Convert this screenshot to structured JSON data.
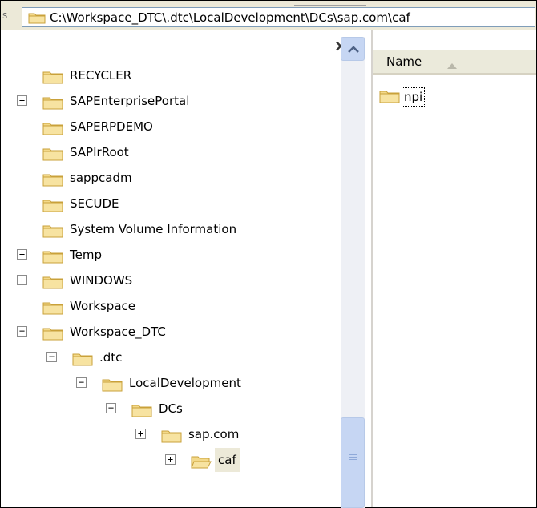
{
  "address": {
    "path": "C:\\Workspace_DTC\\.dtc\\LocalDevelopment\\DCs\\sap.com\\caf"
  },
  "tree": {
    "close_glyph": "×",
    "items": [
      {
        "label": "RECYCLER",
        "expander": "",
        "indent": 0,
        "icon": "folder-icon"
      },
      {
        "label": "SAPEnterprisePortal",
        "expander": "+",
        "indent": 0,
        "icon": "folder-icon"
      },
      {
        "label": "SAPERPDEMO",
        "expander": "",
        "indent": 0,
        "icon": "folder-icon"
      },
      {
        "label": "SAPIrRoot",
        "expander": "",
        "indent": 0,
        "icon": "folder-icon"
      },
      {
        "label": "sappcadm",
        "expander": "",
        "indent": 0,
        "icon": "folder-icon"
      },
      {
        "label": "SECUDE",
        "expander": "",
        "indent": 0,
        "icon": "folder-icon"
      },
      {
        "label": "System Volume Information",
        "expander": "",
        "indent": 0,
        "icon": "folder-icon"
      },
      {
        "label": "Temp",
        "expander": "+",
        "indent": 0,
        "icon": "folder-icon"
      },
      {
        "label": "WINDOWS",
        "expander": "+",
        "indent": 0,
        "icon": "folder-icon"
      },
      {
        "label": "Workspace",
        "expander": "",
        "indent": 0,
        "icon": "folder-icon"
      },
      {
        "label": "Workspace_DTC",
        "expander": "−",
        "indent": 0,
        "icon": "folder-icon"
      },
      {
        "label": ".dtc",
        "expander": "−",
        "indent": 1,
        "icon": "folder-icon"
      },
      {
        "label": "LocalDevelopment",
        "expander": "−",
        "indent": 2,
        "icon": "folder-icon"
      },
      {
        "label": "DCs",
        "expander": "−",
        "indent": 3,
        "icon": "folder-icon"
      },
      {
        "label": "sap.com",
        "expander": "+",
        "indent": 4,
        "icon": "folder-icon"
      },
      {
        "label": "caf",
        "expander": "+",
        "indent": 5,
        "icon": "folder-open-icon",
        "selected": true
      }
    ]
  },
  "list": {
    "columns": [
      {
        "label": "Name",
        "sort": "ascending"
      }
    ],
    "items": [
      {
        "label": "npi",
        "icon": "folder-icon"
      }
    ]
  },
  "colors": {
    "folder": "#f3d98a",
    "folder_edge": "#c9a13a",
    "selection": "#ece9d8",
    "scrollbar": "#c6d6f3"
  }
}
